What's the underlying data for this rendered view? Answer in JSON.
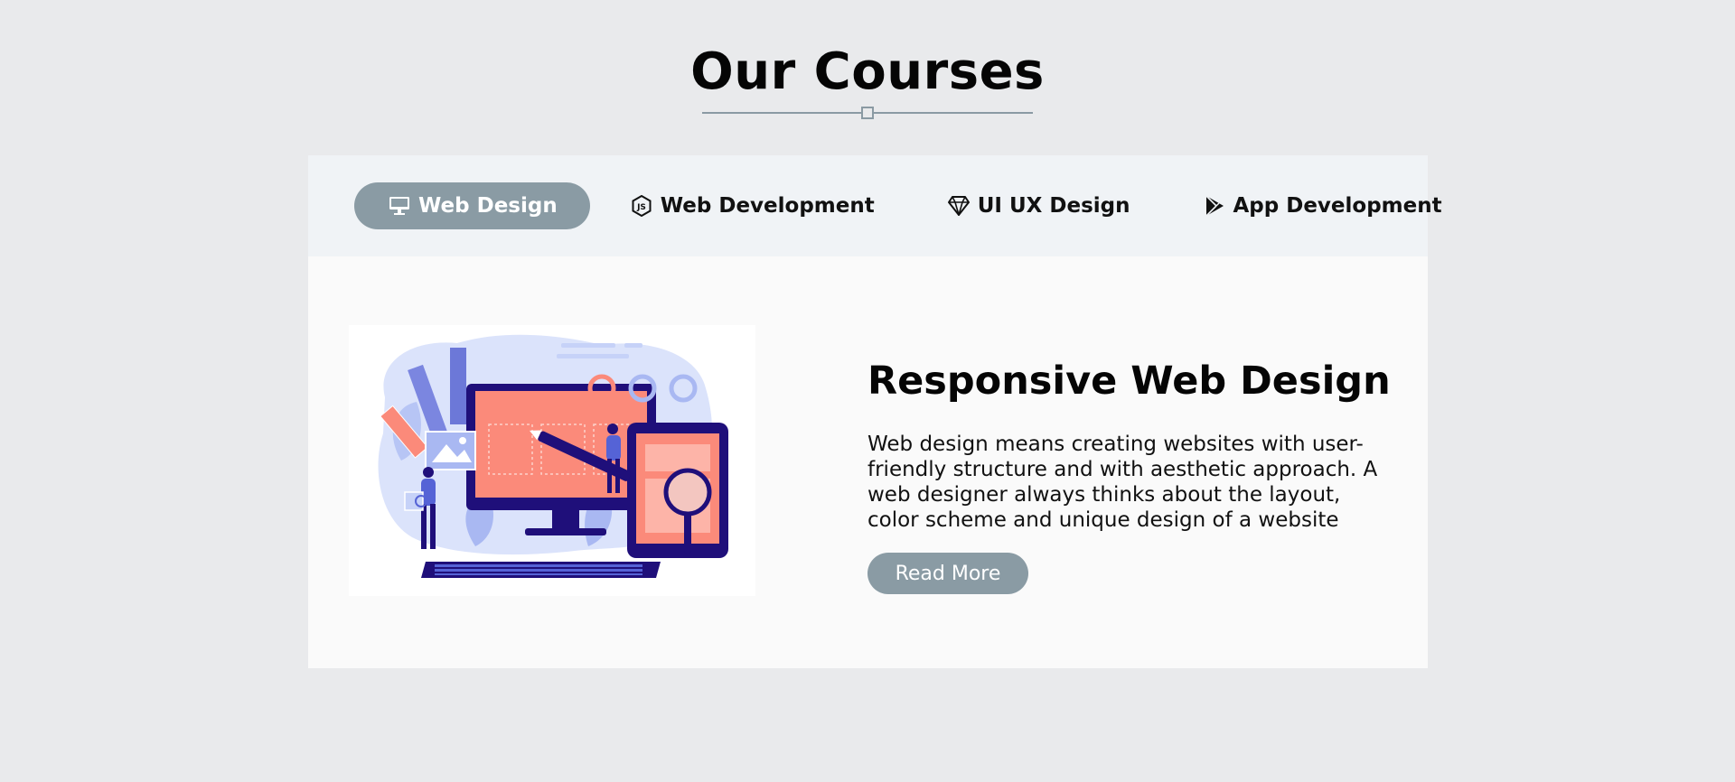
{
  "header": {
    "title": "Our Courses"
  },
  "tabs": [
    {
      "label": "Web Design",
      "icon": "monitor-icon",
      "active": true
    },
    {
      "label": "Web Development",
      "icon": "nodejs-icon",
      "active": false
    },
    {
      "label": "UI UX Design",
      "icon": "gem-icon",
      "active": false
    },
    {
      "label": "App Development",
      "icon": "google-play-icon",
      "active": false
    }
  ],
  "course": {
    "title": "Responsive Web Design",
    "description": "Web design means creating websites with user-friendly structure and with aesthetic approach. A web designer always thinks about the layout, color scheme and unique design of a website",
    "button_label": "Read More",
    "image_icon": "web-design-illustration"
  },
  "colors": {
    "page_background": "#e9eaec",
    "tabbar_background": "#f0f3f6",
    "accent": "#8a9ba4",
    "card_background": "#fafafa",
    "illustration_coral": "#fb8a7a",
    "illustration_navy": "#1f0f7a",
    "illustration_lilac": "#a9b8f2"
  }
}
